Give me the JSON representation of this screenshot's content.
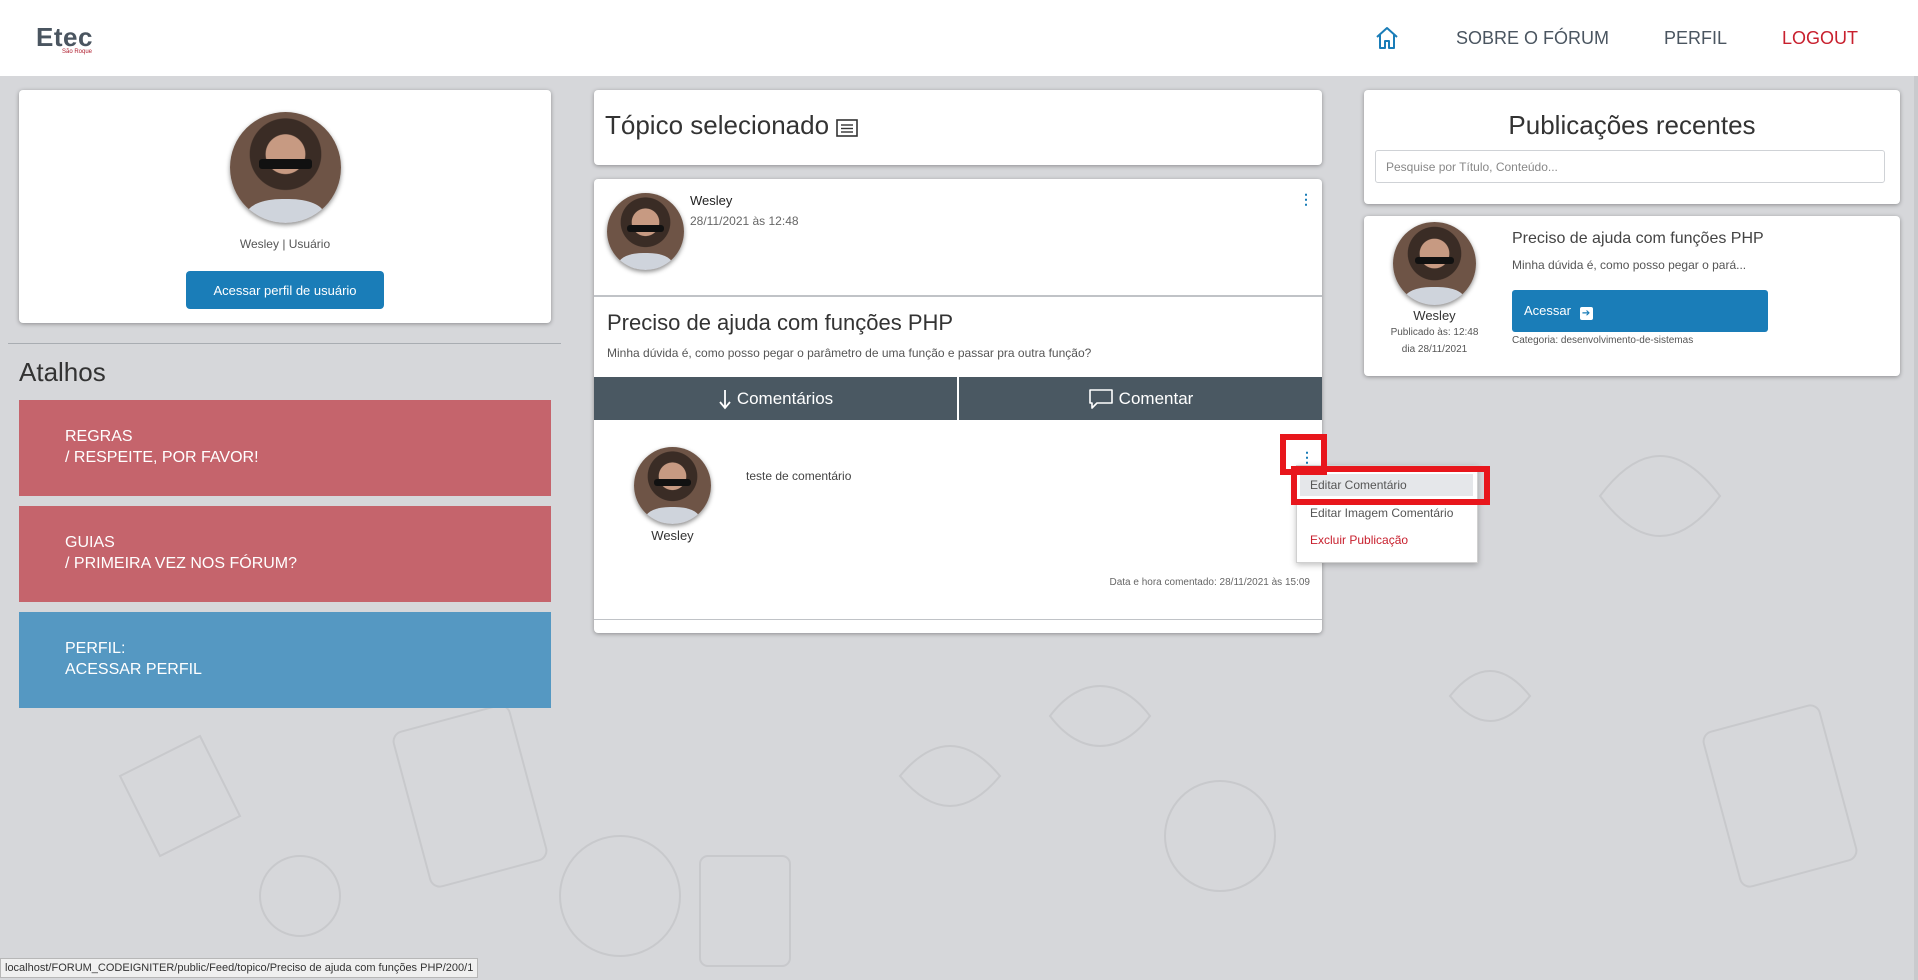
{
  "nav": {
    "logo_main": "Etec",
    "logo_sub": "São Roque",
    "home_icon": "home-icon",
    "items": [
      {
        "label": "SOBRE O FÓRUM"
      },
      {
        "label": "PERFIL"
      },
      {
        "label": "LOGOUT"
      }
    ]
  },
  "profile": {
    "name_role": "Wesley | Usuário",
    "button_label": "Acessar perfil de usuário"
  },
  "shortcuts": {
    "title": "Atalhos",
    "items": [
      {
        "line1": "REGRAS",
        "line2": "/ RESPEITE, POR FAVOR!",
        "color": "#c5646c"
      },
      {
        "line1": "GUIAS",
        "line2": "/ PRIMEIRA VEZ NOS FÓRUM?",
        "color": "#c5646c"
      },
      {
        "line1": "PERFIL:",
        "line2": "ACESSAR PERFIL",
        "color": "#5598c2"
      }
    ]
  },
  "topic": {
    "header": "Tópico selecionado",
    "author": "Wesley",
    "date": "28/11/2021 às 12:48",
    "title": "Preciso de ajuda com funções PHP",
    "body": "Minha dúvida é, como posso pegar o parâmetro de uma função e passar pra outra função?",
    "tabs": [
      {
        "label": "Comentários",
        "icon": "arrow-down-icon"
      },
      {
        "label": "Comentar",
        "icon": "comment-icon"
      }
    ]
  },
  "comment": {
    "author": "Wesley",
    "text": "teste de comentário",
    "date": "Data e hora comentado: 28/11/2021 às 15:09",
    "menu": [
      {
        "label": "Editar Comentário"
      },
      {
        "label": "Editar Imagem Comentário"
      },
      {
        "label": "Excluir Publicação"
      }
    ]
  },
  "recent": {
    "title": "Publicações recentes",
    "search_placeholder": "Pesquise por Título, Conteúdo...",
    "items": [
      {
        "author": "Wesley",
        "published_time": "Publicado às: 12:48",
        "published_day": "dia 28/11/2021",
        "title": "Preciso de ajuda com funções PHP",
        "excerpt": "Minha dúvida é, como posso pegar o pará...",
        "button": "Acessar",
        "category": "Categoria: desenvolvimento-de-sistemas"
      }
    ]
  },
  "status_bar": {
    "url": "localhost/FORUM_CODEIGNITER/public/Feed/topico/Preciso de ajuda com funções PHP/200/1"
  },
  "colors": {
    "primary": "#1a7db8",
    "tab_bg": "#4a5862",
    "logout": "#c8202e",
    "highlight": "#e8161c"
  }
}
